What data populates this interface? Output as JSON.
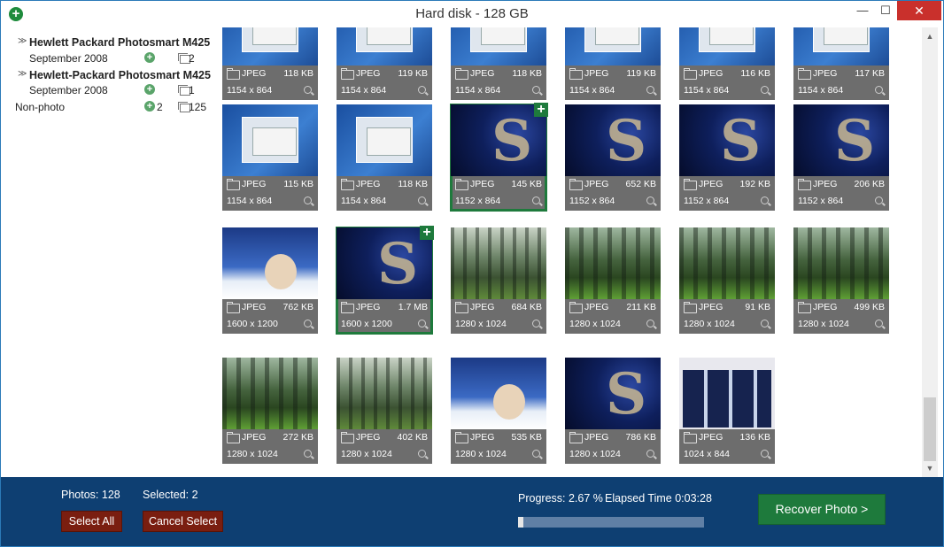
{
  "window": {
    "title": "Hard disk - 128 GB",
    "min_glyph": "—",
    "max_glyph": "☐",
    "close_glyph": "✕",
    "app_icon": "plus-circle-icon"
  },
  "tree": [
    {
      "label": "Hewlett Packard Photosmart M425",
      "expand_glyph": "≫"
    },
    {
      "label": "September 2008",
      "selected_count": "",
      "total_count": "2"
    },
    {
      "label": "Hewlett-Packard Photosmart M425",
      "expand_glyph": "≫"
    },
    {
      "label": "September 2008",
      "selected_count": "",
      "total_count": "1"
    },
    {
      "label": "Non-photo",
      "selected_count": "2",
      "total_count": "125"
    }
  ],
  "photos": [
    {
      "format": "JPEG",
      "size": "118 KB",
      "dims": "1154 x 864",
      "thumb": "screen",
      "selected": false
    },
    {
      "format": "JPEG",
      "size": "119 KB",
      "dims": "1154 x 864",
      "thumb": "screen",
      "selected": false
    },
    {
      "format": "JPEG",
      "size": "118 KB",
      "dims": "1154 x 864",
      "thumb": "screen",
      "selected": false
    },
    {
      "format": "JPEG",
      "size": "119 KB",
      "dims": "1154 x 864",
      "thumb": "screen",
      "selected": false
    },
    {
      "format": "JPEG",
      "size": "116 KB",
      "dims": "1154 x 864",
      "thumb": "screen",
      "selected": false
    },
    {
      "format": "JPEG",
      "size": "117 KB",
      "dims": "1154 x 864",
      "thumb": "screen",
      "selected": false
    },
    {
      "format": "JPEG",
      "size": "115 KB",
      "dims": "1154 x 864",
      "thumb": "screen",
      "selected": false
    },
    {
      "format": "JPEG",
      "size": "118 KB",
      "dims": "1154 x 864",
      "thumb": "screen",
      "selected": false
    },
    {
      "format": "JPEG",
      "size": "145 KB",
      "dims": "1152 x 864",
      "thumb": "dark",
      "selected": true
    },
    {
      "format": "JPEG",
      "size": "652 KB",
      "dims": "1152 x 864",
      "thumb": "dark",
      "selected": false
    },
    {
      "format": "JPEG",
      "size": "192 KB",
      "dims": "1152 x 864",
      "thumb": "dark",
      "selected": false
    },
    {
      "format": "JPEG",
      "size": "206 KB",
      "dims": "1152 x 864",
      "thumb": "dark",
      "selected": false
    },
    {
      "format": "JPEG",
      "size": "762 KB",
      "dims": "1600 x 1200",
      "thumb": "girl",
      "selected": false
    },
    {
      "format": "JPEG",
      "size": "1.7 MB",
      "dims": "1600 x 1200",
      "thumb": "dark",
      "selected": true
    },
    {
      "format": "JPEG",
      "size": "684 KB",
      "dims": "1280 x 1024",
      "thumb": "forest",
      "selected": false
    },
    {
      "format": "JPEG",
      "size": "211 KB",
      "dims": "1280 x 1024",
      "thumb": "forest-green",
      "selected": false
    },
    {
      "format": "JPEG",
      "size": "91 KB",
      "dims": "1280 x 1024",
      "thumb": "forest-green",
      "selected": false
    },
    {
      "format": "JPEG",
      "size": "499 KB",
      "dims": "1280 x 1024",
      "thumb": "forest-green",
      "selected": false
    },
    {
      "format": "JPEG",
      "size": "272 KB",
      "dims": "1280 x 1024",
      "thumb": "forest-green",
      "selected": false
    },
    {
      "format": "JPEG",
      "size": "402 KB",
      "dims": "1280 x 1024",
      "thumb": "forest",
      "selected": false
    },
    {
      "format": "JPEG",
      "size": "535 KB",
      "dims": "1280 x 1024",
      "thumb": "girl",
      "selected": false
    },
    {
      "format": "JPEG",
      "size": "786 KB",
      "dims": "1280 x 1024",
      "thumb": "dark",
      "selected": false
    },
    {
      "format": "JPEG",
      "size": "136 KB",
      "dims": "1024 x 844",
      "thumb": "multi",
      "selected": false
    }
  ],
  "footer": {
    "photos_label": "Photos: 128",
    "selected_label": "Selected: 2",
    "select_all": "Select All",
    "cancel_select": "Cancel Select",
    "progress_label": "Progress: 2.67 %",
    "progress_value": 2.67,
    "elapsed_label": "Elapsed Time  0:03:28",
    "recover_button": "Recover Photo >"
  },
  "colors": {
    "accent_green": "#1e7a3c",
    "footer_blue": "#0e3f72",
    "button_red": "#7a1e10"
  }
}
